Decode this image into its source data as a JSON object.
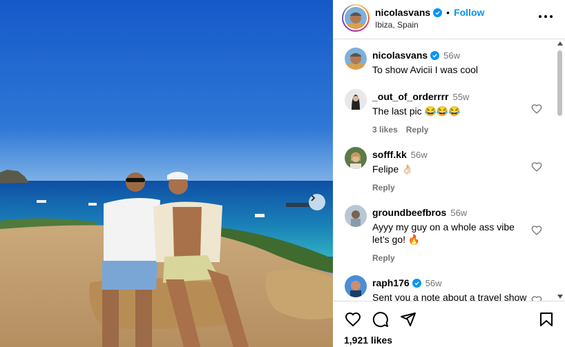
{
  "post": {
    "username": "nicolasvans",
    "separator": "•",
    "follow_label": "Follow",
    "location": "Ibiza, Spain",
    "likes_count": "1,921 likes"
  },
  "comments": [
    {
      "user": "nicolasvans",
      "verified": true,
      "time": "56w",
      "text": "To show Avicii I was cool"
    },
    {
      "user": "_out_of_orderrrr",
      "verified": false,
      "time": "55w",
      "text": "The last pic 😂😂😂",
      "likes": "3 likes",
      "reply": "Reply"
    },
    {
      "user": "sofff.kk",
      "verified": false,
      "time": "56w",
      "text": "Felipe 👌🏻",
      "reply": "Reply"
    },
    {
      "user": "groundbeefbros",
      "verified": false,
      "time": "56w",
      "text": "Ayyy my guy on a whole ass vibe let’s go! 🔥",
      "reply": "Reply"
    },
    {
      "user": "raph176",
      "verified": true,
      "time": "56w",
      "text": "Sent you a note about a travel show"
    }
  ],
  "icons": {
    "more": "more-options-icon",
    "like": "heart-icon",
    "comment": "comment-icon",
    "share": "share-icon",
    "save": "bookmark-icon",
    "next": "chevron-right-icon",
    "verified": "verified-badge-icon"
  },
  "colors": {
    "accent": "#0095f6",
    "muted": "#737373",
    "divider": "#dbdbdb"
  }
}
